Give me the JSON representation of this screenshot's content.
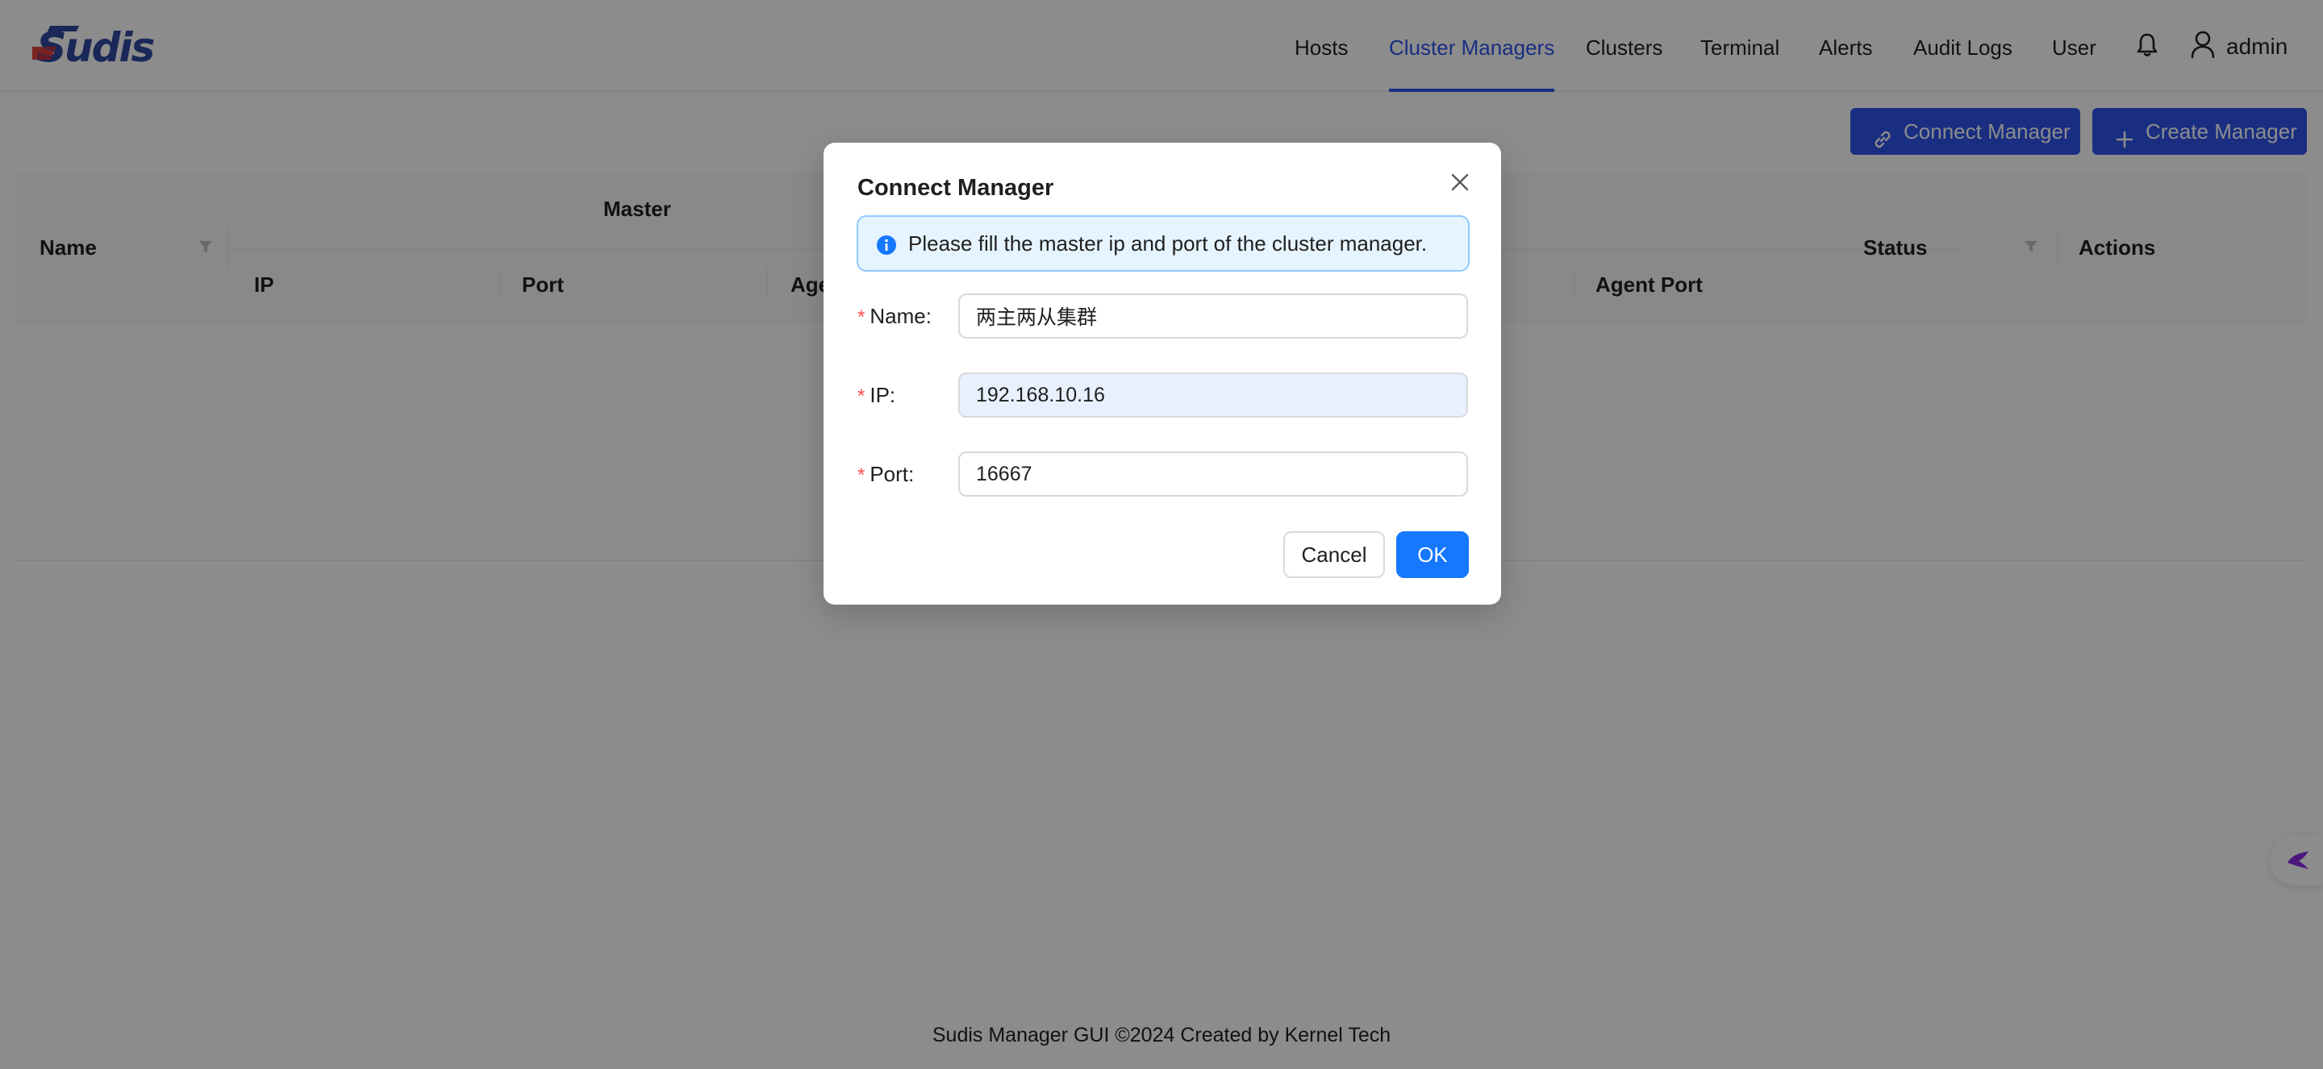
{
  "app": {
    "brand": "Sudis"
  },
  "nav": {
    "items": [
      {
        "label": "Hosts"
      },
      {
        "label": "Cluster Managers",
        "active": true
      },
      {
        "label": "Clusters"
      },
      {
        "label": "Terminal"
      },
      {
        "label": "Alerts"
      },
      {
        "label": "Audit Logs"
      },
      {
        "label": "User"
      }
    ],
    "notification_icon": "bell-icon",
    "user_icon": "user-icon",
    "username": "admin"
  },
  "toolbar": {
    "connect_label": "Connect Manager",
    "connect_icon": "link-icon",
    "create_label": "Create Manager",
    "create_icon": "plus-icon"
  },
  "table": {
    "columns": {
      "name": "Name",
      "master_group": "Master",
      "ip": "IP",
      "port": "Port",
      "agent_port_partial": "Age",
      "agent_port": "Agent Port",
      "status": "Status",
      "actions": "Actions"
    },
    "rows": []
  },
  "footer": {
    "text": "Sudis Manager GUI ©2024 Created by Kernel Tech"
  },
  "modal": {
    "title": "Connect Manager",
    "info_text": "Please fill the master ip and port of the cluster manager.",
    "fields": {
      "name": {
        "label": "Name:",
        "value": "两主两从集群"
      },
      "ip": {
        "label": "IP:",
        "value": "192.168.10.16"
      },
      "port": {
        "label": "Port:",
        "value": "16667"
      }
    },
    "cancel_label": "Cancel",
    "ok_label": "OK"
  },
  "colors": {
    "primary": "#2f54eb",
    "ok_button": "#1677ff",
    "required_mark": "#ff4d4f",
    "info_bg": "#e6f4ff",
    "info_border": "#91caff",
    "brand_blue": "#2e4a9e",
    "brand_red": "#d92b2b"
  }
}
